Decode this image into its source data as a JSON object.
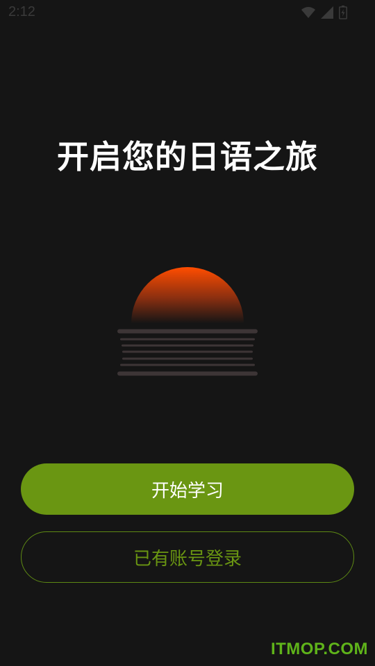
{
  "status_bar": {
    "time": "2:12",
    "icons": [
      "wifi-icon",
      "cellular-signal-icon",
      "battery-icon"
    ]
  },
  "main": {
    "title": "开启您的日语之旅",
    "illustration": "sunset-icon"
  },
  "actions": {
    "start_label": "开始学习",
    "login_label": "已有账号登录"
  },
  "watermark": "ITMOP.COM",
  "colors": {
    "background": "#151515",
    "accent": "#6a9612",
    "sun_top": "#ff4d00",
    "sun_bottom": "#151515",
    "watermark": "#5fb31a"
  }
}
